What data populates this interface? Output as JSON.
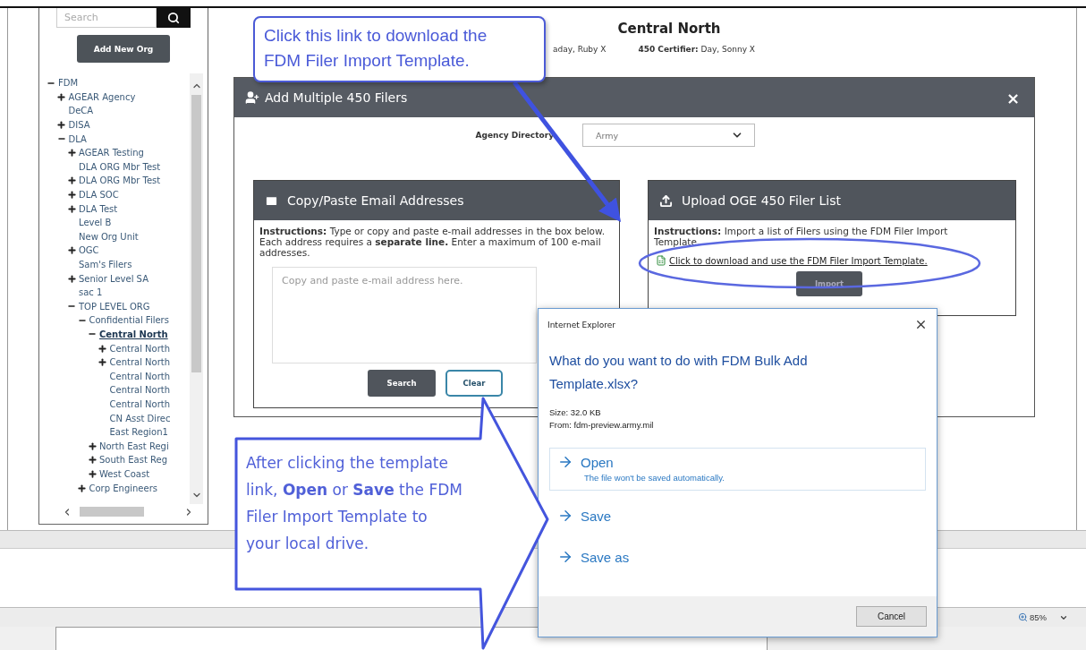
{
  "sidebar": {
    "search": {
      "placeholder": "Search"
    },
    "add_button": "Add New Org",
    "tree": [
      {
        "label": "FDM",
        "expanded": true,
        "selected": false,
        "children": [
          {
            "label": "AGEAR Agency",
            "expanded": false,
            "selected": false
          },
          {
            "label": "DeCA",
            "selected": false
          },
          {
            "label": "DISA",
            "expanded": false,
            "selected": false
          },
          {
            "label": "DLA",
            "expanded": true,
            "selected": false,
            "children": [
              {
                "label": "AGEAR Testing",
                "expanded": false,
                "selected": false
              },
              {
                "label": "DLA ORG Mbr Test",
                "selected": false
              },
              {
                "label": "DLA ORG Mbr Test",
                "expanded": false,
                "selected": false
              },
              {
                "label": "DLA SOC",
                "expanded": false,
                "selected": false
              },
              {
                "label": "DLA Test",
                "expanded": false,
                "selected": false
              },
              {
                "label": "Level B",
                "selected": false
              },
              {
                "label": "New Org Unit",
                "selected": false
              },
              {
                "label": "OGC",
                "expanded": false,
                "selected": false
              },
              {
                "label": "Sam's Filers",
                "selected": false
              },
              {
                "label": "Senior Level SA",
                "expanded": false,
                "selected": false
              },
              {
                "label": "sac 1",
                "selected": false
              },
              {
                "label": "TOP LEVEL ORG",
                "expanded": true,
                "selected": false,
                "children": [
                  {
                    "label": "Confidential Filers",
                    "expanded": true,
                    "selected": false,
                    "children": [
                      {
                        "label": "Central North",
                        "expanded": true,
                        "selected": true,
                        "children": [
                          {
                            "label": "Central North",
                            "expanded": false,
                            "selected": false
                          },
                          {
                            "label": "Central North",
                            "expanded": false,
                            "selected": false
                          },
                          {
                            "label": "Central North",
                            "selected": false
                          },
                          {
                            "label": "Central North",
                            "selected": false
                          },
                          {
                            "label": "Central North",
                            "selected": false
                          },
                          {
                            "label": "CN Asst Direc",
                            "selected": false
                          },
                          {
                            "label": "East Region1",
                            "selected": false
                          }
                        ]
                      },
                      {
                        "label": "North East Regi",
                        "expanded": false,
                        "selected": false
                      },
                      {
                        "label": "South East Reg",
                        "expanded": false,
                        "selected": false
                      },
                      {
                        "label": "West Coast",
                        "expanded": false,
                        "selected": false
                      }
                    ]
                  },
                  {
                    "label": "Corp Engineers",
                    "expanded": false,
                    "selected": false
                  }
                ]
              }
            ]
          }
        ]
      }
    ]
  },
  "header": {
    "title": "Central North",
    "meta": [
      "aday, Ruby X",
      "**450 Certifier:** Day, Sonny X"
    ]
  },
  "modal": {
    "title": "Add Multiple 450 Filers",
    "close": "×",
    "agency_label": "Agency Directory",
    "agency_value": "Army",
    "email_panel": {
      "title": "Copy/Paste Email Addresses",
      "instructions": "**Instructions:** Type or copy and paste e-mail addresses in the box below. Each address requires a **separate line.** Enter a maximum of 100 e-mail addresses.",
      "placeholder": "Copy and paste e-mail address here.",
      "buttons": [
        "Search",
        "Clear"
      ]
    },
    "upload_panel": {
      "title": "Upload OGE 450 Filer List",
      "instructions": "**Instructions:** Import a list of Filers using the FDM Filer Import Template.",
      "link": "Click to download and use the FDM Filer Import Template.",
      "button": "Import"
    }
  },
  "download_dialog": {
    "app": "Internet Explorer",
    "question": "What do you want to do with FDM Bulk Add Template.xlsx?",
    "size": "Size: 32.0 KB",
    "from": "From: fdm-preview.army.mil",
    "options": [
      {
        "label": "Open",
        "note": "The file won't be saved automatically.",
        "selected": true
      },
      {
        "label": "Save",
        "selected": false
      },
      {
        "label": "Save as",
        "selected": false
      }
    ],
    "cancel": "Cancel"
  },
  "callouts": [
    "Click this link to download the FDM Filer Import Template.",
    "After clicking the template link, **Open** or **Save** the FDM Filer Import Template to your local drive."
  ],
  "status_bar": {
    "zoom": "85%"
  }
}
